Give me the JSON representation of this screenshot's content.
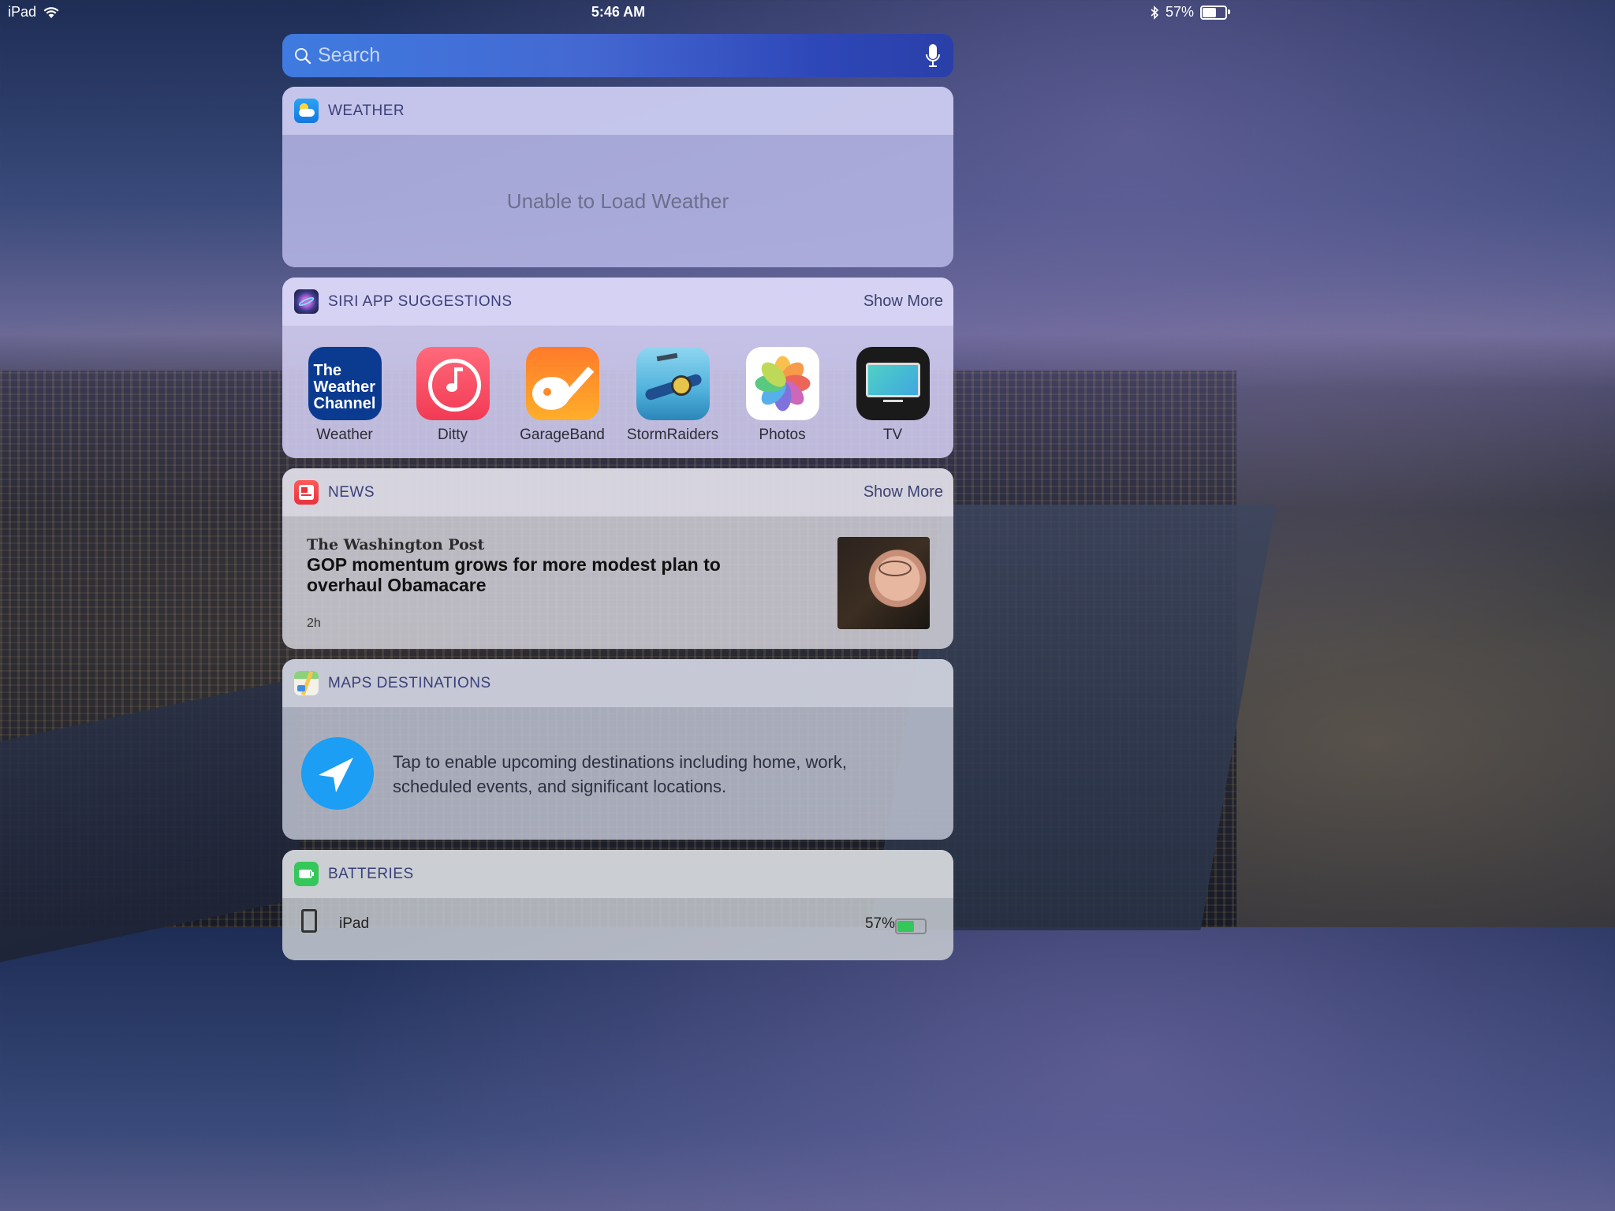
{
  "status_bar": {
    "device": "iPad",
    "time": "5:46 AM",
    "battery_percent": "57%",
    "battery_level": 0.57
  },
  "search": {
    "placeholder": "Search"
  },
  "widgets": {
    "weather": {
      "title": "WEATHER",
      "message": "Unable to Load Weather"
    },
    "siri": {
      "title": "SIRI APP SUGGESTIONS",
      "show_more": "Show More",
      "apps": [
        {
          "label": "Weather",
          "icon": "weather-channel-icon",
          "icon_text": "The Weather Channel"
        },
        {
          "label": "Ditty",
          "icon": "ditty-icon"
        },
        {
          "label": "GarageBand",
          "icon": "garageband-icon"
        },
        {
          "label": "StormRaiders",
          "icon": "stormraiders-icon"
        },
        {
          "label": "Photos",
          "icon": "photos-icon"
        },
        {
          "label": "TV",
          "icon": "tv-icon"
        }
      ]
    },
    "news": {
      "title": "NEWS",
      "show_more": "Show More",
      "publisher": "The Washington Post",
      "headline": "GOP momentum grows for more modest plan to overhaul Obamacare",
      "age": "2h"
    },
    "maps": {
      "title": "MAPS DESTINATIONS",
      "message": "Tap to enable upcoming destinations including home, work, scheduled events, and significant locations."
    },
    "batteries": {
      "title": "BATTERIES",
      "devices": [
        {
          "name": "iPad",
          "percent": "57%",
          "level": 0.57
        }
      ]
    }
  },
  "colors": {
    "search_gradient_start": "#3f7be0",
    "search_gradient_end": "#2a3fa8",
    "header_text": "#3b3f7a",
    "maps_accent": "#1b9ef3",
    "battery_green": "#34c759"
  }
}
